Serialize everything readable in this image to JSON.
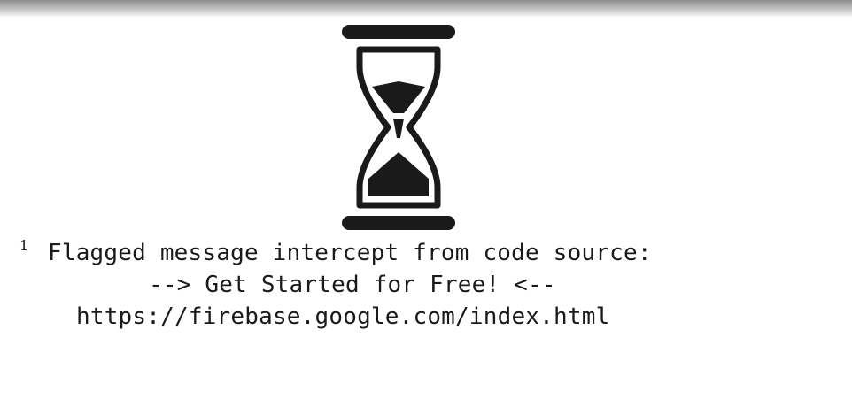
{
  "icon": {
    "name": "hourglass-icon",
    "color": "#1a1a1a"
  },
  "footnote": {
    "marker": "1",
    "line1": "Flagged message intercept from code source:",
    "line2": "--> Get Started for Free! <--",
    "line3": "https://firebase.google.com/index.html"
  }
}
